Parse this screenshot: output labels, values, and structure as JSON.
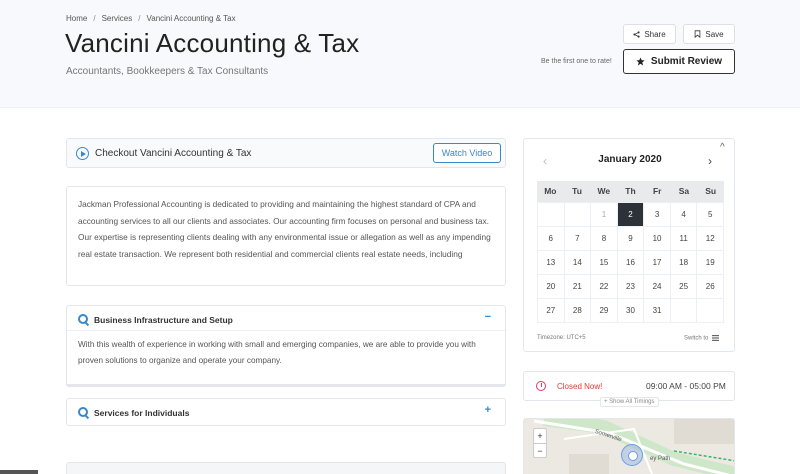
{
  "breadcrumb": {
    "home": "Home",
    "sep1": "/",
    "services": "Services",
    "sep2": "/",
    "current": "Vancini Accounting & Tax"
  },
  "header": {
    "title": "Vancini Accounting & Tax",
    "subtitle": "Accountants, Bookkeepers & Tax Consultants",
    "share_label": "Share",
    "save_label": "Save",
    "rate_text": "Be the first one to rate!",
    "submit_label": "Submit Review"
  },
  "icons": {
    "share": "share-icon",
    "save": "bookmark-icon",
    "star": "star-icon",
    "play": "play-icon",
    "question": "question-icon",
    "clock": "clock-icon",
    "switch": "list-icon"
  },
  "video": {
    "title": "Checkout Vancini Accounting & Tax",
    "button_label": "Watch Video"
  },
  "description": "Jackman Professional Accounting is dedicated to providing and maintaining the highest standard of CPA and accounting services to all our clients and associates. Our accounting firm focuses on personal and business tax. Our expertise is representing clients dealing with any environmental issue or allegation as well as any impending real estate transaction. We represent both residential and commercial clients real estate needs, including",
  "accordion": [
    {
      "title": "Business Infrastructure and Setup",
      "toggle": "−",
      "body": "With this wealth of experience in working with small and emerging companies, we are able to provide you with proven solutions to organize and operate your company."
    },
    {
      "title": "Services for Individuals",
      "toggle": "+"
    }
  ],
  "calendar": {
    "month": "January 2020",
    "prev": "‹",
    "next": "›",
    "collapse": "^",
    "weekdays": [
      "Mo",
      "Tu",
      "We",
      "Th",
      "Fr",
      "Sa",
      "Su"
    ],
    "weeks": [
      [
        "",
        "",
        "1",
        "2",
        "3",
        "4",
        "5"
      ],
      [
        "6",
        "7",
        "8",
        "9",
        "10",
        "11",
        "12"
      ],
      [
        "13",
        "14",
        "15",
        "16",
        "17",
        "18",
        "19"
      ],
      [
        "20",
        "21",
        "22",
        "23",
        "24",
        "25",
        "26"
      ],
      [
        "27",
        "28",
        "29",
        "30",
        "31",
        "",
        ""
      ]
    ],
    "today": "2",
    "timezone": "Timezone: UTC+5",
    "switch_label": "Switch to"
  },
  "hours": {
    "status": "Closed Now!",
    "range": "09:00 AM - 05:00 PM",
    "show_all": "+ Show All Timings"
  },
  "map": {
    "zoom_in": "+",
    "zoom_out": "−",
    "road_label": "Somerville",
    "path_label": "ey Path"
  },
  "colors": {
    "accent": "#3a88c8",
    "closed": "#e53935",
    "today_bg": "#2d3238"
  }
}
